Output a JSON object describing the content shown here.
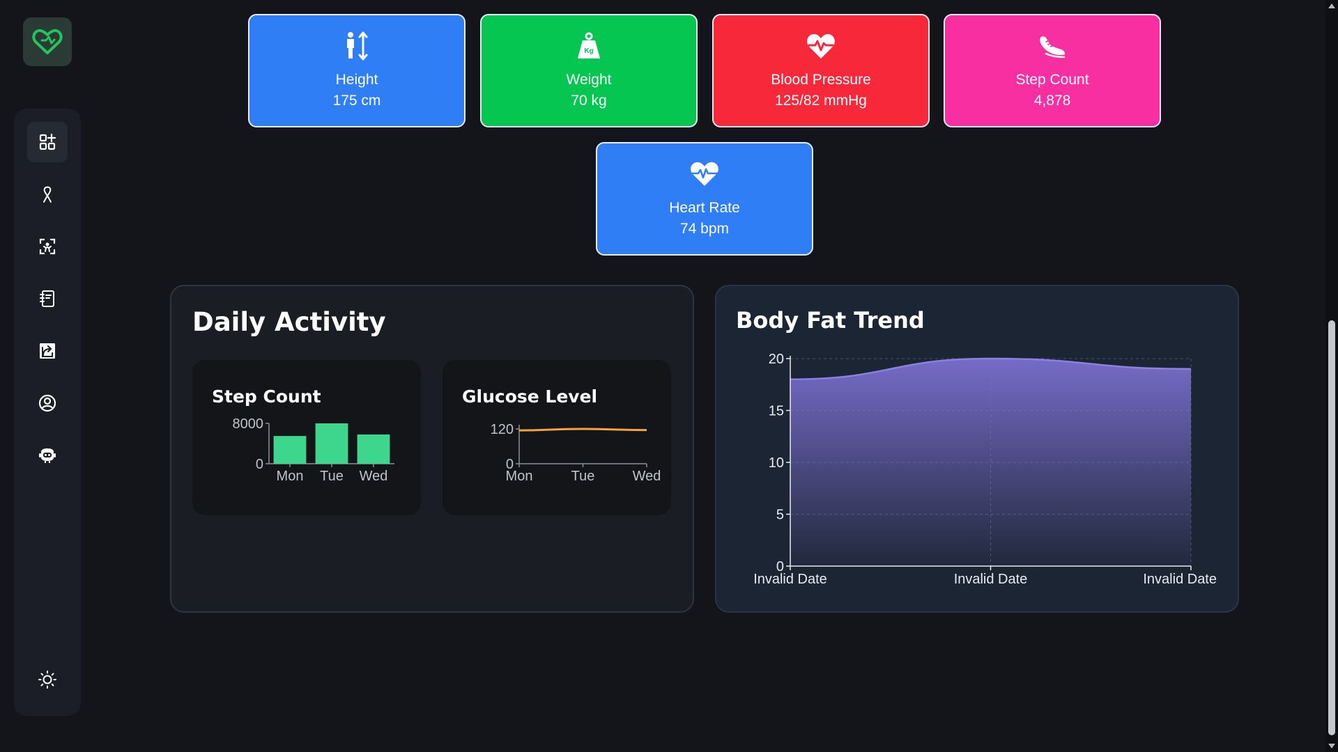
{
  "app": {
    "logo_icon": "heart-logo-icon",
    "accent": "#22c55e"
  },
  "sidebar": {
    "items": [
      {
        "name": "dashboard",
        "icon": "dashboard-grid-icon",
        "active": true
      },
      {
        "name": "awareness",
        "icon": "ribbon-icon"
      },
      {
        "name": "scan",
        "icon": "scan-icon"
      },
      {
        "name": "records",
        "icon": "notebook-icon"
      },
      {
        "name": "share",
        "icon": "share-icon"
      },
      {
        "name": "profile",
        "icon": "user-circle-icon"
      },
      {
        "name": "chatbot",
        "icon": "bot-icon"
      }
    ],
    "theme_icon": "sun-icon"
  },
  "stats": [
    {
      "label": "Height",
      "value": "175 cm",
      "icon": "height-icon",
      "color": "#2f7ef6"
    },
    {
      "label": "Weight",
      "value": "70 kg",
      "icon": "weight-icon",
      "color": "#04c650"
    },
    {
      "label": "Blood Pressure",
      "value": "125/82 mmHg",
      "icon": "heart-pulse-icon",
      "color": "#f7283a"
    },
    {
      "label": "Step Count",
      "value": "4,878",
      "icon": "shoe-icon",
      "color": "#f72fa0"
    },
    {
      "label": "Heart Rate",
      "value": "74 bpm",
      "icon": "heart-rate-icon",
      "color": "#2f7ef6"
    }
  ],
  "daily_activity": {
    "title": "Daily Activity",
    "step_title": "Step Count",
    "glucose_title": "Glucose Level"
  },
  "body_fat": {
    "title": "Body Fat Trend"
  },
  "chart_data": [
    {
      "type": "bar",
      "title": "Step Count",
      "categories": [
        "Mon",
        "Tue",
        "Wed"
      ],
      "values": [
        5500,
        8000,
        5800
      ],
      "ylim": [
        0,
        8000
      ],
      "yticks": [
        "8000",
        "0"
      ],
      "color": "#3dd68c"
    },
    {
      "type": "line",
      "title": "Glucose Level",
      "categories": [
        "Mon",
        "Tue",
        "Wed"
      ],
      "values": [
        115,
        120,
        116
      ],
      "ylim": [
        0,
        120
      ],
      "yticks": [
        "120",
        "0"
      ],
      "color": "#f5a33b"
    },
    {
      "type": "area",
      "title": "Body Fat Trend",
      "categories": [
        "Invalid Date",
        "Invalid Date",
        "Invalid Date"
      ],
      "values": [
        18,
        20,
        19
      ],
      "ylim": [
        0,
        20
      ],
      "yticks": [
        "20",
        "15",
        "10",
        "5",
        "0"
      ],
      "grid": true,
      "color": "#7b6fd0"
    }
  ]
}
